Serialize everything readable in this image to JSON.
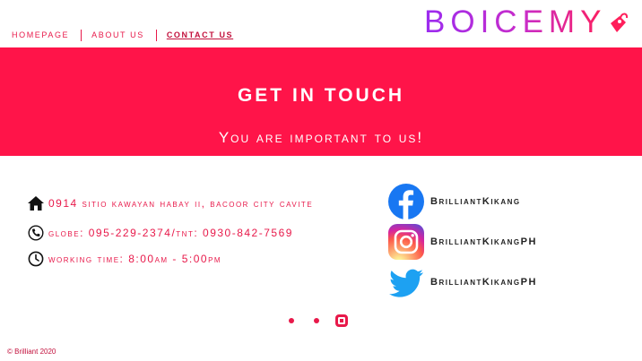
{
  "nav": {
    "items": [
      {
        "label": "HOMEPAGE"
      },
      {
        "label": "ABOUT US"
      },
      {
        "label": "CONTACT US"
      }
    ]
  },
  "logo": {
    "text": "BOICEMY"
  },
  "hero": {
    "title": "GET IN TOUCH",
    "subtitle": "You are important to us!"
  },
  "contact": {
    "address": "0914 sitio kawayan habay ii, bacoor city cavite",
    "phone": "globe: 095-229-2374/tnt: 0930-842-7569",
    "hours": "working time: 8:00am - 5:00pm"
  },
  "social": {
    "facebook": "BrilliantKikang",
    "instagram": "BrilliantKikangPH",
    "twitter": "BrilliantKikangPH"
  },
  "carousel": {
    "active_index": 2,
    "count": 3
  },
  "footer": {
    "text": "© Brilliant 2020"
  },
  "colors": {
    "accent": "#ff1449",
    "facebook": "#1877f2",
    "twitter": "#1da1f2"
  },
  "icons": {
    "address": "home-icon",
    "phone": "phone-icon",
    "hours": "clock-icon"
  }
}
